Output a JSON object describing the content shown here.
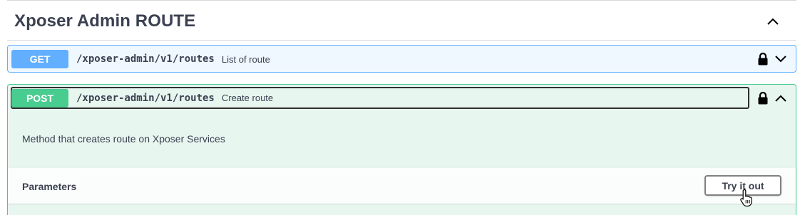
{
  "section": {
    "title": "Xposer Admin ROUTE",
    "toggle_icon": "chevron-up-icon"
  },
  "operations": [
    {
      "method": "GET",
      "path": "/xposer-admin/v1/routes",
      "summary": "List of route",
      "color": "#61affe",
      "expanded": false
    },
    {
      "method": "POST",
      "path": "/xposer-admin/v1/routes",
      "summary": "Create route",
      "color": "#49cc90",
      "expanded": true,
      "description": "Method that creates route on Xposer Services",
      "parameters_label": "Parameters",
      "try_button": "Try it out"
    }
  ],
  "colors": {
    "text": "#3b4151",
    "get": "#61affe",
    "post": "#49cc90"
  }
}
